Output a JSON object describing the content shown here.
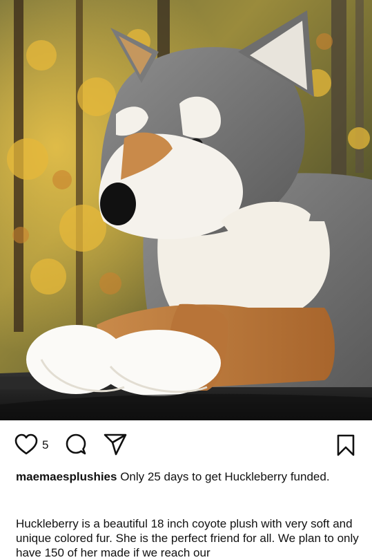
{
  "photo": {
    "alt_subject": "coyote-plush-photo"
  },
  "actions": {
    "like_count": "5",
    "icons": [
      "heart-icon",
      "comment-icon",
      "share-icon",
      "bookmark-icon"
    ]
  },
  "post": {
    "username": "maemaesplushies",
    "caption": "Only 25 days to get Huckleberry funded.",
    "description": "Huckleberry is a beautiful 18 inch coyote plush with very soft and unique colored fur. She is the perfect friend for all. We plan to only have 150 of her made if we reach our"
  }
}
